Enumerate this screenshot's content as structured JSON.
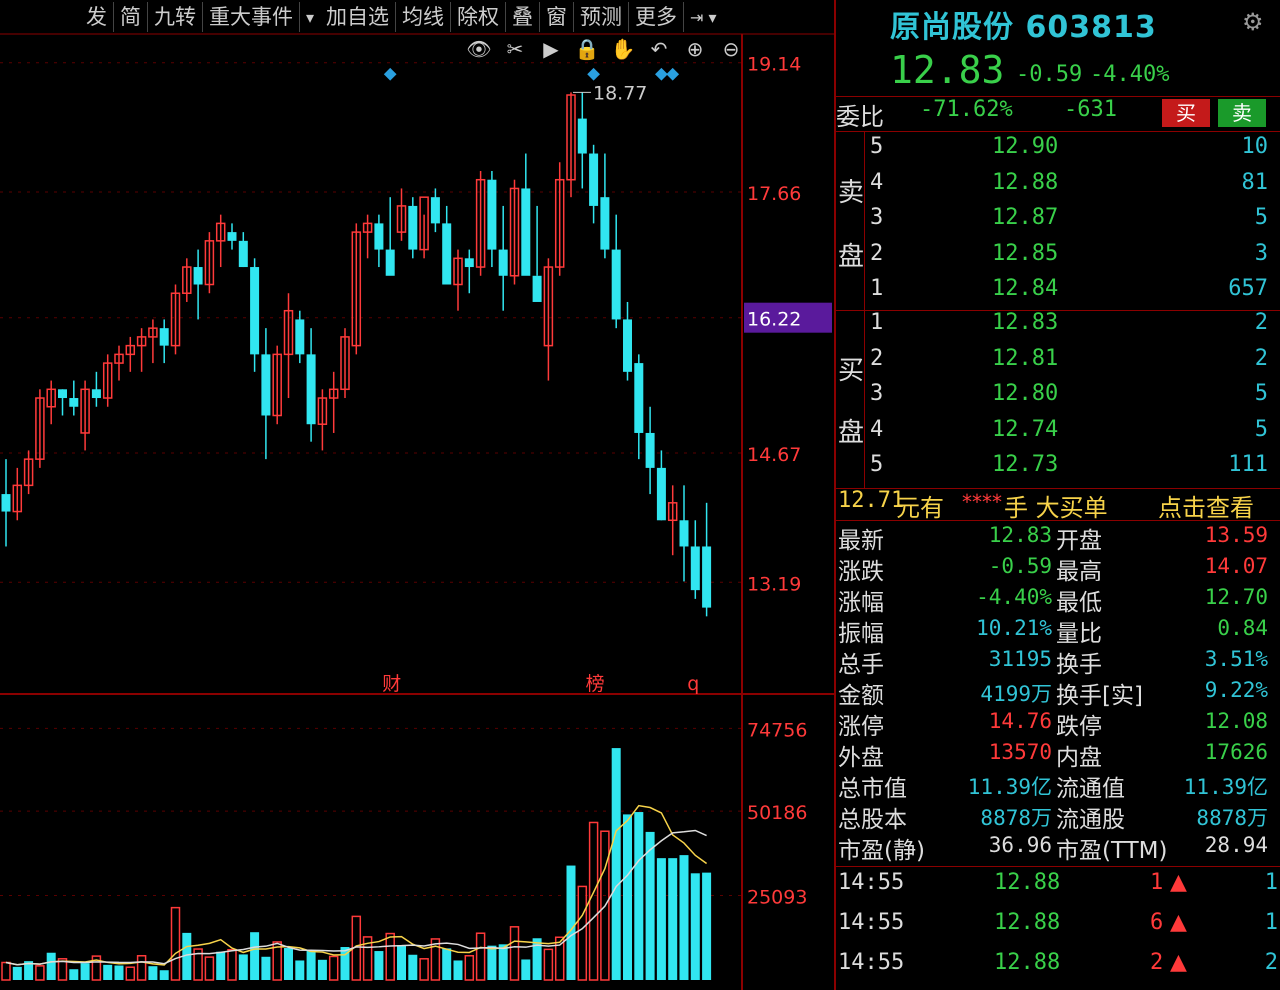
{
  "toolbar": {
    "items": [
      "发",
      "简",
      "九转",
      "重大事件",
      "加自选",
      "均线",
      "除权",
      "叠",
      "窗",
      "预测",
      "更多"
    ]
  },
  "icons": [
    "eye-icon",
    "scissors-icon",
    "play-icon",
    "lock-icon",
    "hand-icon",
    "undo-icon",
    "zoom-in-icon",
    "zoom-out-icon"
  ],
  "price_axis": [
    "19.14",
    "17.66",
    "16.22",
    "14.67",
    "13.19"
  ],
  "high_marker": "18.77",
  "event_markers": [
    "财",
    "榜",
    "q"
  ],
  "volume_axis": [
    "74756",
    "50186",
    "25093"
  ],
  "colors": {
    "up": "#ff3a3a",
    "down": "#31e6f0",
    "ma5": "#f7d34a",
    "ma10": "#dddddd",
    "grid": "#8b0000",
    "highlight": "#5a1a9c"
  },
  "chart_data": {
    "type": "candlestick",
    "ylim": [
      12.3,
      19.4
    ],
    "candles": [
      [
        14.2,
        14.6,
        13.6,
        14.0
      ],
      [
        14.0,
        14.5,
        13.9,
        14.3
      ],
      [
        14.3,
        14.7,
        14.2,
        14.6
      ],
      [
        14.6,
        15.4,
        14.5,
        15.3
      ],
      [
        15.2,
        15.5,
        15.0,
        15.4
      ],
      [
        15.4,
        15.4,
        15.1,
        15.3
      ],
      [
        15.3,
        15.5,
        15.1,
        15.2
      ],
      [
        14.9,
        15.5,
        14.7,
        15.4
      ],
      [
        15.4,
        15.6,
        15.2,
        15.3
      ],
      [
        15.3,
        15.8,
        15.2,
        15.7
      ],
      [
        15.7,
        15.9,
        15.5,
        15.8
      ],
      [
        15.8,
        16.0,
        15.6,
        15.9
      ],
      [
        15.9,
        16.1,
        15.6,
        16.0
      ],
      [
        16.0,
        16.2,
        15.7,
        16.1
      ],
      [
        16.1,
        16.2,
        15.7,
        15.9
      ],
      [
        15.9,
        16.6,
        15.8,
        16.5
      ],
      [
        16.5,
        16.9,
        16.4,
        16.8
      ],
      [
        16.8,
        17.0,
        16.2,
        16.6
      ],
      [
        16.6,
        17.2,
        16.5,
        17.1
      ],
      [
        17.1,
        17.4,
        16.8,
        17.3
      ],
      [
        17.2,
        17.3,
        17.0,
        17.1
      ],
      [
        17.1,
        17.2,
        16.8,
        16.8
      ],
      [
        16.8,
        16.9,
        15.6,
        15.8
      ],
      [
        15.8,
        16.1,
        14.6,
        15.1
      ],
      [
        15.1,
        15.9,
        15.0,
        15.8
      ],
      [
        15.8,
        16.5,
        15.3,
        16.3
      ],
      [
        16.2,
        16.3,
        15.7,
        15.8
      ],
      [
        15.8,
        16.1,
        14.8,
        15.0
      ],
      [
        15.0,
        15.4,
        14.7,
        15.3
      ],
      [
        15.3,
        15.6,
        14.9,
        15.4
      ],
      [
        15.4,
        16.1,
        15.3,
        16.0
      ],
      [
        15.9,
        17.3,
        15.8,
        17.2
      ],
      [
        17.2,
        17.4,
        16.9,
        17.3
      ],
      [
        17.3,
        17.4,
        16.8,
        17.0
      ],
      [
        17.0,
        17.6,
        16.8,
        16.7
      ],
      [
        17.2,
        17.7,
        17.1,
        17.5
      ],
      [
        17.5,
        17.6,
        16.9,
        17.0
      ],
      [
        17.0,
        17.4,
        16.9,
        17.6
      ],
      [
        17.6,
        17.7,
        17.2,
        17.3
      ],
      [
        17.3,
        17.5,
        16.6,
        16.6
      ],
      [
        16.6,
        17.0,
        16.3,
        16.9
      ],
      [
        16.9,
        17.0,
        16.5,
        16.8
      ],
      [
        16.8,
        17.9,
        16.7,
        17.8
      ],
      [
        17.8,
        17.9,
        16.8,
        17.0
      ],
      [
        17.0,
        17.5,
        16.3,
        16.7
      ],
      [
        16.7,
        17.8,
        16.6,
        17.7
      ],
      [
        17.7,
        18.1,
        16.9,
        16.7
      ],
      [
        16.7,
        17.5,
        16.7,
        16.4
      ],
      [
        15.9,
        16.9,
        15.5,
        16.8
      ],
      [
        16.8,
        18.0,
        16.7,
        17.8
      ],
      [
        17.8,
        18.8,
        17.6,
        18.77
      ],
      [
        18.5,
        18.8,
        17.7,
        18.1
      ],
      [
        18.1,
        18.2,
        17.3,
        17.5
      ],
      [
        17.6,
        18.1,
        16.9,
        17.0
      ],
      [
        17.0,
        17.4,
        16.1,
        16.2
      ],
      [
        16.2,
        16.4,
        15.5,
        15.6
      ],
      [
        15.7,
        15.8,
        14.6,
        14.9
      ],
      [
        14.9,
        15.2,
        14.2,
        14.5
      ],
      [
        14.5,
        14.7,
        13.9,
        13.9
      ],
      [
        13.9,
        14.3,
        13.5,
        14.1
      ],
      [
        13.9,
        14.3,
        13.2,
        13.6
      ],
      [
        13.6,
        13.9,
        13.0,
        13.1
      ],
      [
        13.6,
        14.1,
        12.8,
        12.9
      ]
    ],
    "volume_ylim": [
      0,
      82000
    ],
    "volumes": [
      [
        5200,
        1
      ],
      [
        3900,
        0
      ],
      [
        5600,
        0
      ],
      [
        4200,
        1
      ],
      [
        8100,
        0
      ],
      [
        6300,
        1
      ],
      [
        3200,
        0
      ],
      [
        5000,
        0
      ],
      [
        7100,
        1
      ],
      [
        4500,
        0
      ],
      [
        4300,
        0
      ],
      [
        3800,
        1
      ],
      [
        7200,
        1
      ],
      [
        4100,
        0
      ],
      [
        2900,
        0
      ],
      [
        21500,
        1
      ],
      [
        14000,
        0
      ],
      [
        9200,
        1
      ],
      [
        6800,
        1
      ],
      [
        8400,
        0
      ],
      [
        9000,
        1
      ],
      [
        7600,
        0
      ],
      [
        14200,
        0
      ],
      [
        6900,
        0
      ],
      [
        11300,
        1
      ],
      [
        9500,
        0
      ],
      [
        5800,
        0
      ],
      [
        8900,
        0
      ],
      [
        6000,
        0
      ],
      [
        7000,
        1
      ],
      [
        9800,
        0
      ],
      [
        18900,
        1
      ],
      [
        12800,
        1
      ],
      [
        8600,
        0
      ],
      [
        13800,
        1
      ],
      [
        10400,
        0
      ],
      [
        7500,
        0
      ],
      [
        6300,
        1
      ],
      [
        12200,
        1
      ],
      [
        9400,
        0
      ],
      [
        5800,
        0
      ],
      [
        7200,
        1
      ],
      [
        13900,
        1
      ],
      [
        10200,
        0
      ],
      [
        10600,
        0
      ],
      [
        15800,
        1
      ],
      [
        6100,
        0
      ],
      [
        12400,
        0
      ],
      [
        9100,
        1
      ],
      [
        12700,
        1
      ],
      [
        34000,
        0
      ],
      [
        27800,
        1
      ],
      [
        46800,
        1
      ],
      [
        44200,
        1
      ],
      [
        68900,
        0
      ],
      [
        49200,
        0
      ],
      [
        49900,
        0
      ],
      [
        44000,
        0
      ],
      [
        36200,
        0
      ],
      [
        36200,
        0
      ],
      [
        37100,
        0
      ],
      [
        31700,
        0
      ],
      [
        31900,
        0
      ]
    ]
  },
  "header": {
    "name": "原尚股份",
    "code": "603813",
    "price": "12.83",
    "change": "-0.59",
    "change_pct": "-4.40%"
  },
  "weibi": {
    "label": "委比",
    "pct": "-71.62%",
    "diff": "-631",
    "buy_label": "买",
    "sell_label": "卖"
  },
  "ask_label": [
    "卖",
    "盘"
  ],
  "bid_label": [
    "买",
    "盘"
  ],
  "asks": [
    {
      "level": "5",
      "price": "12.90",
      "vol": "10"
    },
    {
      "level": "4",
      "price": "12.88",
      "vol": "81"
    },
    {
      "level": "3",
      "price": "12.87",
      "vol": "5"
    },
    {
      "level": "2",
      "price": "12.85",
      "vol": "3"
    },
    {
      "level": "1",
      "price": "12.84",
      "vol": "657"
    }
  ],
  "bids": [
    {
      "level": "1",
      "price": "12.83",
      "vol": "2"
    },
    {
      "level": "2",
      "price": "12.81",
      "vol": "2"
    },
    {
      "level": "3",
      "price": "12.80",
      "vol": "5"
    },
    {
      "level": "4",
      "price": "12.74",
      "vol": "5"
    },
    {
      "level": "5",
      "price": "12.73",
      "vol": "111"
    }
  ],
  "bigorder": {
    "price": "12.71",
    "text1": "元有",
    "stars": "****",
    "text2": "手 大买单",
    "link": "点击查看"
  },
  "stats": [
    {
      "k1": "最新",
      "v1": "12.83",
      "c1": "green",
      "k2": "开盘",
      "v2": "13.59",
      "c2": "red"
    },
    {
      "k1": "涨跌",
      "v1": "-0.59",
      "c1": "green",
      "k2": "最高",
      "v2": "14.07",
      "c2": "red"
    },
    {
      "k1": "涨幅",
      "v1": "-4.40%",
      "c1": "green",
      "k2": "最低",
      "v2": "12.70",
      "c2": "green"
    },
    {
      "k1": "振幅",
      "v1": "10.21%",
      "c1": "cyan",
      "k2": "量比",
      "v2": "0.84",
      "c2": "green"
    },
    {
      "k1": "总手",
      "v1": "31195",
      "c1": "cyan",
      "k2": "换手",
      "v2": "3.51%",
      "c2": "cyan"
    },
    {
      "k1": "金额",
      "v1": "4199万",
      "c1": "cyan",
      "k2": "换手[实]",
      "v2": "9.22%",
      "c2": "cyan"
    },
    {
      "k1": "涨停",
      "v1": "14.76",
      "c1": "red",
      "k2": "跌停",
      "v2": "12.08",
      "c2": "green"
    },
    {
      "k1": "外盘",
      "v1": "13570",
      "c1": "red",
      "k2": "内盘",
      "v2": "17626",
      "c2": "green"
    },
    {
      "k1": "总市值",
      "v1": "11.39亿",
      "c1": "cyan",
      "k2": "流通值",
      "v2": "11.39亿",
      "c2": "cyan"
    },
    {
      "k1": "总股本",
      "v1": "8878万",
      "c1": "cyan",
      "k2": "流通股",
      "v2": "8878万",
      "c2": "cyan"
    },
    {
      "k1": "市盈(静)",
      "v1": "36.96",
      "c1": "white",
      "k2": "市盈(TTM)",
      "v2": "28.94",
      "c2": "white"
    }
  ],
  "ticks": [
    {
      "time": "14:55",
      "price": "12.88",
      "vol": "1",
      "num": "1"
    },
    {
      "time": "14:55",
      "price": "12.88",
      "vol": "6",
      "num": "1"
    },
    {
      "time": "14:55",
      "price": "12.88",
      "vol": "2",
      "num": "2"
    }
  ]
}
